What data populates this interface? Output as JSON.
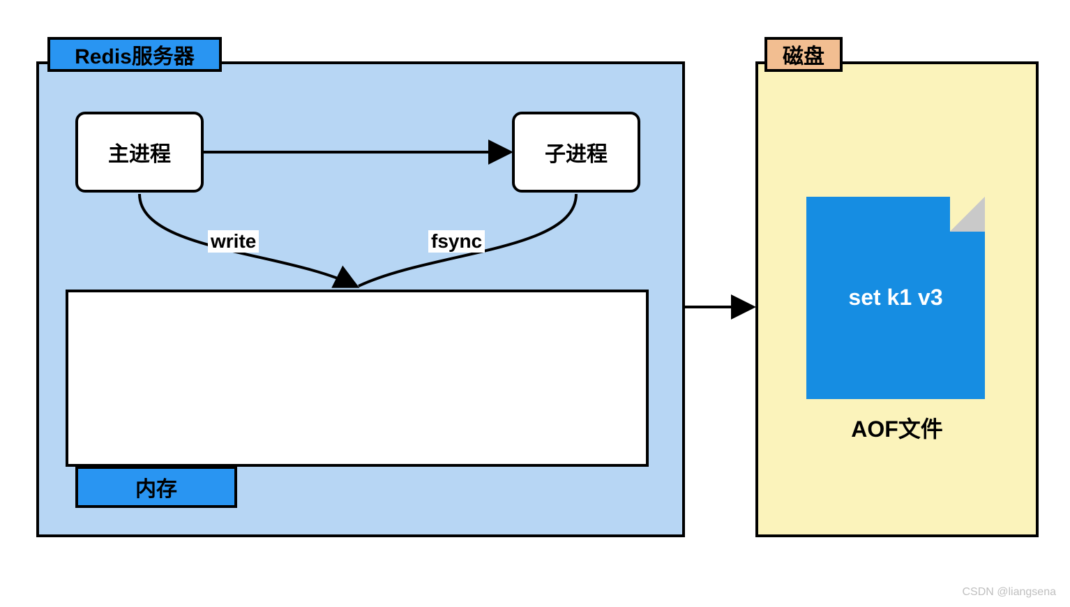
{
  "server": {
    "title": "Redis服务器"
  },
  "main_process_label": "主进程",
  "child_process_label": "子进程",
  "memory_label": "内存",
  "edges": {
    "write": "write",
    "fsync": "fsync"
  },
  "disk": {
    "title": "磁盘",
    "file_content": "set k1 v3",
    "file_caption": "AOF文件"
  },
  "watermark": "CSDN @liangsena"
}
